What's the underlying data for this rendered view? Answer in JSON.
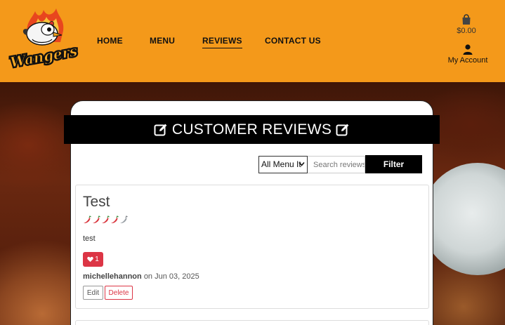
{
  "brand": {
    "logo_text": "Wangers"
  },
  "nav": {
    "items": [
      {
        "label": "HOME"
      },
      {
        "label": "MENU"
      },
      {
        "label": "REVIEWS",
        "active": true
      },
      {
        "label": "CONTACT US"
      }
    ]
  },
  "basket": {
    "amount": "$0.00",
    "icon": "shopping-bag-icon"
  },
  "account": {
    "label": "My Account",
    "icon": "user-icon"
  },
  "page": {
    "title": "CUSTOMER REVIEWS",
    "title_icon": "edit-icon"
  },
  "filter": {
    "select_value": "All Menu It",
    "search_placeholder": "Search reviews",
    "button_label": "Filter"
  },
  "reviews": [
    {
      "title": "Test",
      "rating": 4,
      "rating_max": 5,
      "rating_icon": "chili-pepper-icon",
      "body": "test",
      "likes": "1",
      "author": "michellehannon",
      "date_text": "on Jun 03, 2025",
      "edit_label": "Edit",
      "delete_label": "Delete"
    }
  ],
  "colors": {
    "header_bg": "#f4991a",
    "title_bar_bg": "#000000",
    "danger": "#dc3545",
    "rating_filled": "#d9363e",
    "rating_empty": "#9aa0a6"
  }
}
